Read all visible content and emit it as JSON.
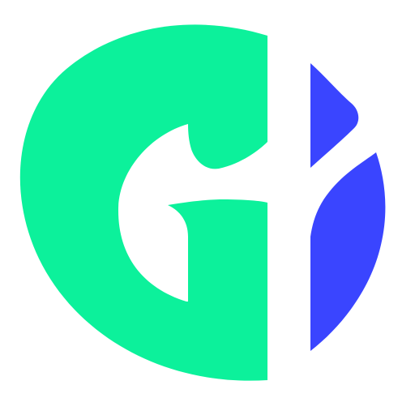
{
  "logo": {
    "name": "brand-logo",
    "colors": {
      "background": "#ffffff",
      "green": "#0cf19b",
      "blue": "#3a45ff"
    }
  }
}
